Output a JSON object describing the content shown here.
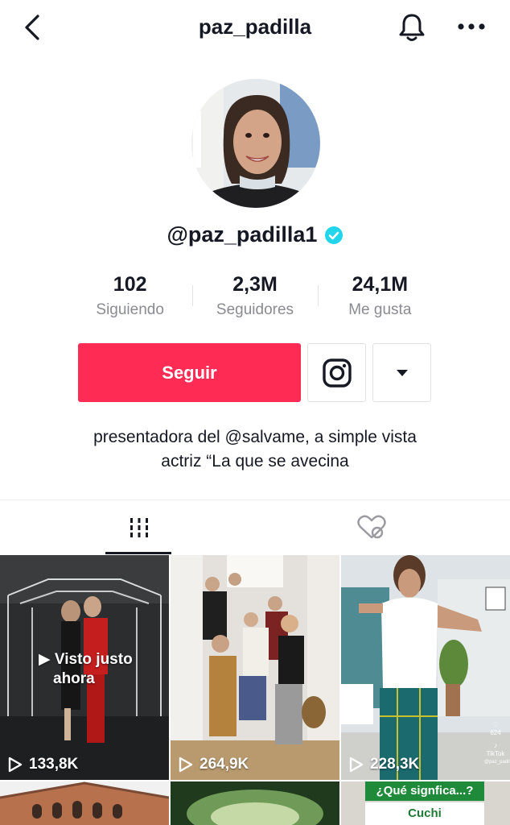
{
  "header": {
    "title": "paz_padilla"
  },
  "profile": {
    "handle": "@paz_padilla1",
    "verified": true
  },
  "stats": [
    {
      "value": "102",
      "label": "Siguiendo"
    },
    {
      "value": "2,3M",
      "label": "Seguidores"
    },
    {
      "value": "24,1M",
      "label": "Me gusta"
    }
  ],
  "actions": {
    "follow_label": "Seguir"
  },
  "bio": {
    "line1": "presentadora del  @salvame, a simple vista",
    "line2": "actriz “La que se avecina"
  },
  "tabs": [
    {
      "icon": "grid-icon",
      "active": true
    },
    {
      "icon": "liked-hidden-icon",
      "active": false
    }
  ],
  "videos": [
    {
      "views": "133,8K",
      "overlay_line1": "Visto justo",
      "overlay_line2": "ahora"
    },
    {
      "views": "264,9K"
    },
    {
      "views": "228,3K",
      "watermark_count": "624",
      "watermark_brand": "TikTok",
      "watermark_user": "@paz_padilla1"
    },
    {
      "views": ""
    },
    {
      "views": ""
    },
    {
      "views": "",
      "caption_top": "¿Qué signfica...?",
      "caption_bottom": "Cuchi"
    }
  ],
  "colors": {
    "accent": "#fe2c55",
    "verified": "#20d5ec",
    "text_primary": "#161823",
    "text_secondary": "#8a8b91"
  }
}
